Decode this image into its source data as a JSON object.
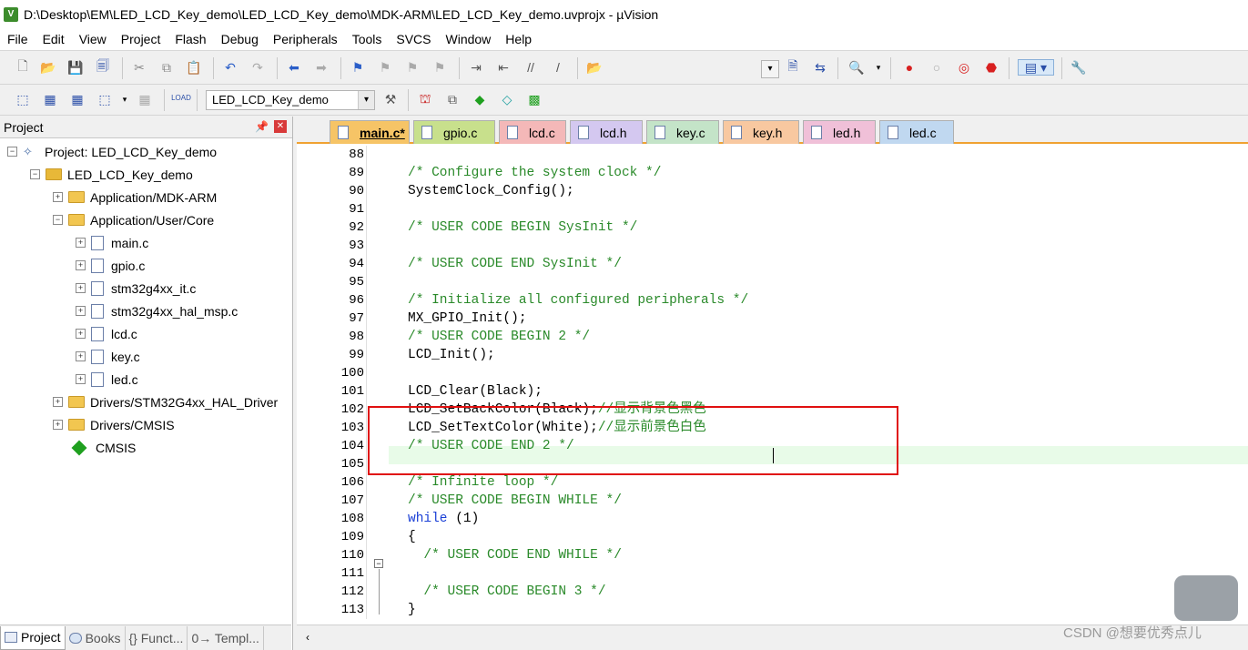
{
  "window": {
    "title": "D:\\Desktop\\EM\\LED_LCD_Key_demo\\LED_LCD_Key_demo\\MDK-ARM\\LED_LCD_Key_demo.uvprojx - µVision"
  },
  "menu": [
    "File",
    "Edit",
    "View",
    "Project",
    "Flash",
    "Debug",
    "Peripherals",
    "Tools",
    "SVCS",
    "Window",
    "Help"
  ],
  "toolbar2": {
    "target_value": "LED_LCD_Key_demo"
  },
  "project_panel": {
    "title": "Project",
    "tree": [
      {
        "label": "Project: LED_LCD_Key_demo",
        "kind": "project"
      },
      {
        "label": "LED_LCD_Key_demo",
        "kind": "target"
      },
      {
        "label": "Application/MDK-ARM",
        "kind": "folder"
      },
      {
        "label": "Application/User/Core",
        "kind": "folder"
      },
      {
        "label": "main.c",
        "kind": "file"
      },
      {
        "label": "gpio.c",
        "kind": "file"
      },
      {
        "label": "stm32g4xx_it.c",
        "kind": "file"
      },
      {
        "label": "stm32g4xx_hal_msp.c",
        "kind": "file"
      },
      {
        "label": "lcd.c",
        "kind": "file"
      },
      {
        "label": "key.c",
        "kind": "file"
      },
      {
        "label": "led.c",
        "kind": "file"
      },
      {
        "label": "Drivers/STM32G4xx_HAL_Driver",
        "kind": "folder"
      },
      {
        "label": "Drivers/CMSIS",
        "kind": "folder"
      },
      {
        "label": "CMSIS",
        "kind": "component"
      }
    ],
    "bottom_tabs": [
      "Project",
      "Books",
      "{} Funct...",
      "0→ Templ..."
    ]
  },
  "editor": {
    "tabs": [
      {
        "label": "main.c*",
        "color": "#f6c466",
        "active": true
      },
      {
        "label": "gpio.c",
        "color": "#c8e08c",
        "active": false
      },
      {
        "label": "lcd.c",
        "color": "#f4b8b8",
        "active": false
      },
      {
        "label": "lcd.h",
        "color": "#d4c8f0",
        "active": false
      },
      {
        "label": "key.c",
        "color": "#c4e4c8",
        "active": false
      },
      {
        "label": "key.h",
        "color": "#f8c8a0",
        "active": false
      },
      {
        "label": "led.h",
        "color": "#f0c0d8",
        "active": false
      },
      {
        "label": "led.c",
        "color": "#c0d8f0",
        "active": false
      }
    ],
    "line_numbers": [
      "88",
      "89",
      "90",
      "91",
      "92",
      "93",
      "94",
      "95",
      "96",
      "97",
      "98",
      "99",
      "100",
      "101",
      "102",
      "103",
      "104",
      "105",
      "106",
      "107",
      "108",
      "109",
      "110",
      "111",
      "112",
      "113"
    ],
    "code": [
      {
        "plain": ""
      },
      {
        "comment": "/* Configure the system clock */"
      },
      {
        "plain": "SystemClock_Config();"
      },
      {
        "plain": ""
      },
      {
        "comment": "/* USER CODE BEGIN SysInit */"
      },
      {
        "plain": ""
      },
      {
        "comment": "/* USER CODE END SysInit */"
      },
      {
        "plain": ""
      },
      {
        "comment": "/* Initialize all configured peripherals */"
      },
      {
        "plain": "MX_GPIO_Init();"
      },
      {
        "comment": "/* USER CODE BEGIN 2 */"
      },
      {
        "plain": "LCD_Init();"
      },
      {
        "plain": ""
      },
      {
        "plain": "LCD_Clear(Black);"
      },
      {
        "plain": "LCD_SetBackColor(Black);",
        "comment": "//显示背景色黑色"
      },
      {
        "plain": "LCD_SetTextColor(White);",
        "comment": "//显示前景色白色"
      },
      {
        "comment": "/* USER CODE END 2 */"
      },
      {
        "plain": ""
      },
      {
        "comment": "/* Infinite loop */"
      },
      {
        "comment": "/* USER CODE BEGIN WHILE */"
      },
      {
        "keyword": "while",
        "plain": " (1)"
      },
      {
        "plain": "{"
      },
      {
        "comment": "  /* USER CODE END WHILE */"
      },
      {
        "plain": ""
      },
      {
        "comment": "  /* USER CODE BEGIN 3 */"
      },
      {
        "plain": "}"
      }
    ]
  },
  "watermark": "CSDN @想要优秀点儿"
}
